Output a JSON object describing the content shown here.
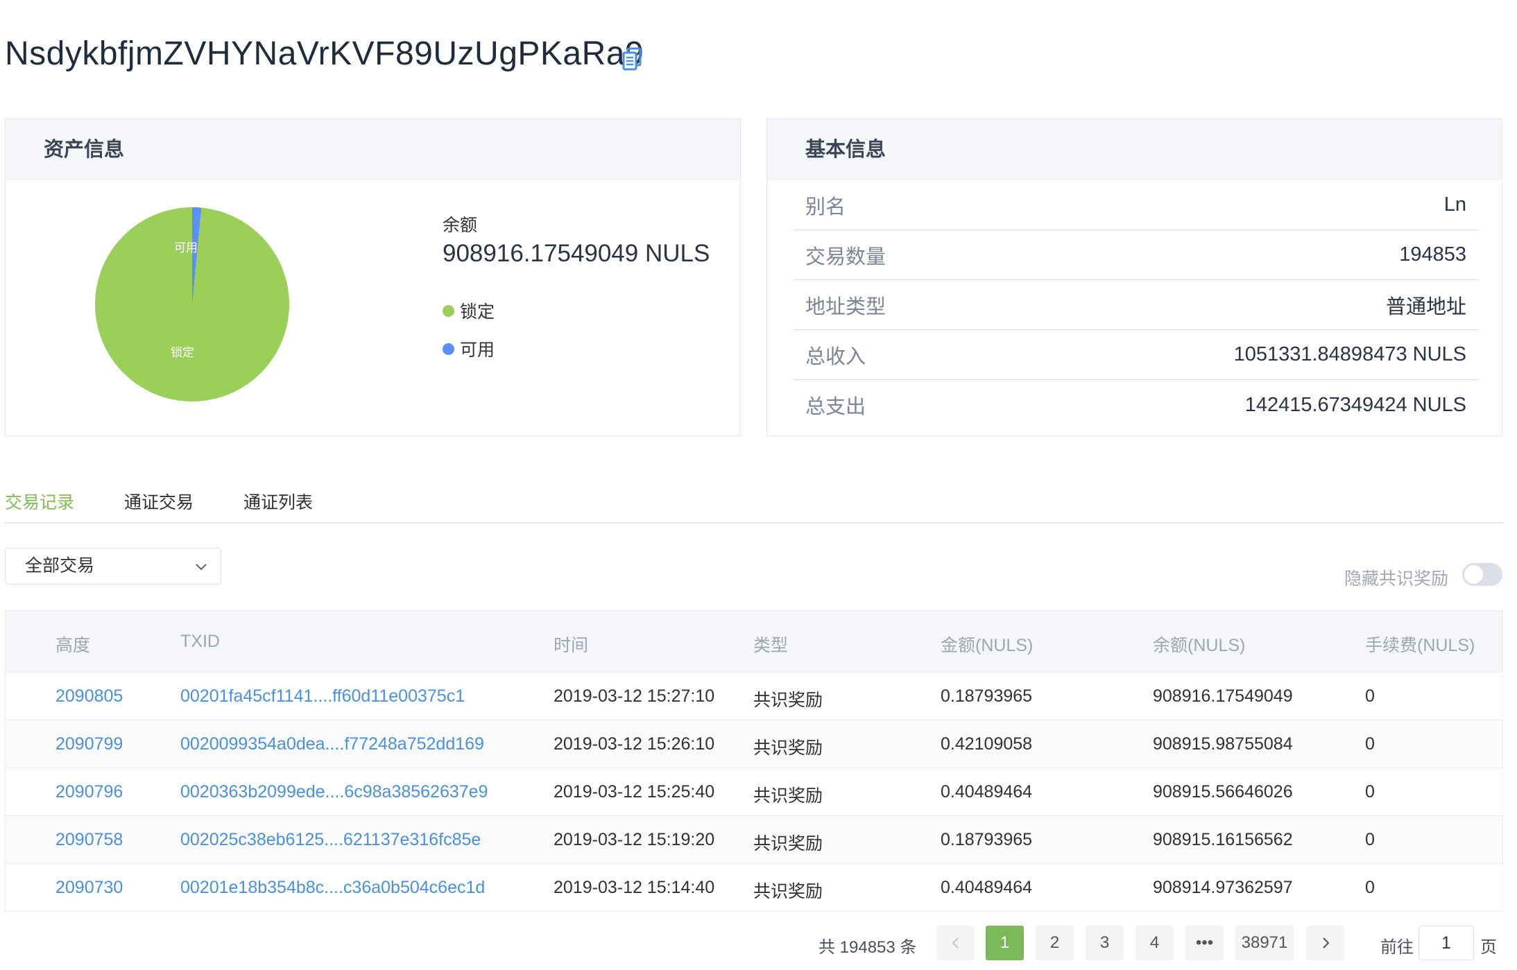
{
  "address": "NsdykbfjmZVHYNaVrKVF89UzUgPKaRa9",
  "asset_card": {
    "title": "资产信息",
    "balance_label": "余额",
    "balance_value": "908916.17549049 NULS",
    "legend": [
      {
        "label": "锁定",
        "color": "#9ccf5a"
      },
      {
        "label": "可用",
        "color": "#5b8ff9"
      }
    ],
    "pie": {
      "locked_label": "锁定",
      "available_label": "可用",
      "available_fraction": 0.015
    }
  },
  "basic_card": {
    "title": "基本信息",
    "rows": [
      {
        "key": "别名",
        "value": "Ln"
      },
      {
        "key": "交易数量",
        "value": "194853"
      },
      {
        "key": "地址类型",
        "value": "普通地址"
      },
      {
        "key": "总收入",
        "value": "1051331.84898473 NULS"
      },
      {
        "key": "总支出",
        "value": "142415.67349424 NULS"
      }
    ]
  },
  "tabs": [
    "交易记录",
    "通证交易",
    "通证列表"
  ],
  "filter": {
    "selected": "全部交易"
  },
  "hide_toggle_label": "隐藏共识奖励",
  "table": {
    "headers": [
      "高度",
      "TXID",
      "时间",
      "类型",
      "金额(NULS)",
      "余额(NULS)",
      "手续费(NULS)"
    ],
    "rows": [
      [
        "2090805",
        "00201fa45cf1141....ff60d11e00375c1",
        "2019-03-12 15:27:10",
        "共识奖励",
        "0.18793965",
        "908916.17549049",
        "0"
      ],
      [
        "2090799",
        "0020099354a0dea....f77248a752dd169",
        "2019-03-12 15:26:10",
        "共识奖励",
        "0.42109058",
        "908915.98755084",
        "0"
      ],
      [
        "2090796",
        "0020363b2099ede....6c98a38562637e9",
        "2019-03-12 15:25:40",
        "共识奖励",
        "0.40489464",
        "908915.56646026",
        "0"
      ],
      [
        "2090758",
        "002025c38eb6125....621137e316fc85e",
        "2019-03-12 15:19:20",
        "共识奖励",
        "0.18793965",
        "908915.16156562",
        "0"
      ],
      [
        "2090730",
        "00201e18b354b8c....c36a0b504c6ec1d",
        "2019-03-12 15:14:40",
        "共识奖励",
        "0.40489464",
        "908914.97362597",
        "0"
      ]
    ]
  },
  "pagination": {
    "total_text": "共 194853 条",
    "pages": [
      "1",
      "2",
      "3",
      "4",
      "•••",
      "38971"
    ],
    "current": "1",
    "goto_label": "前往",
    "goto_value": "1",
    "page_suffix": "页"
  }
}
